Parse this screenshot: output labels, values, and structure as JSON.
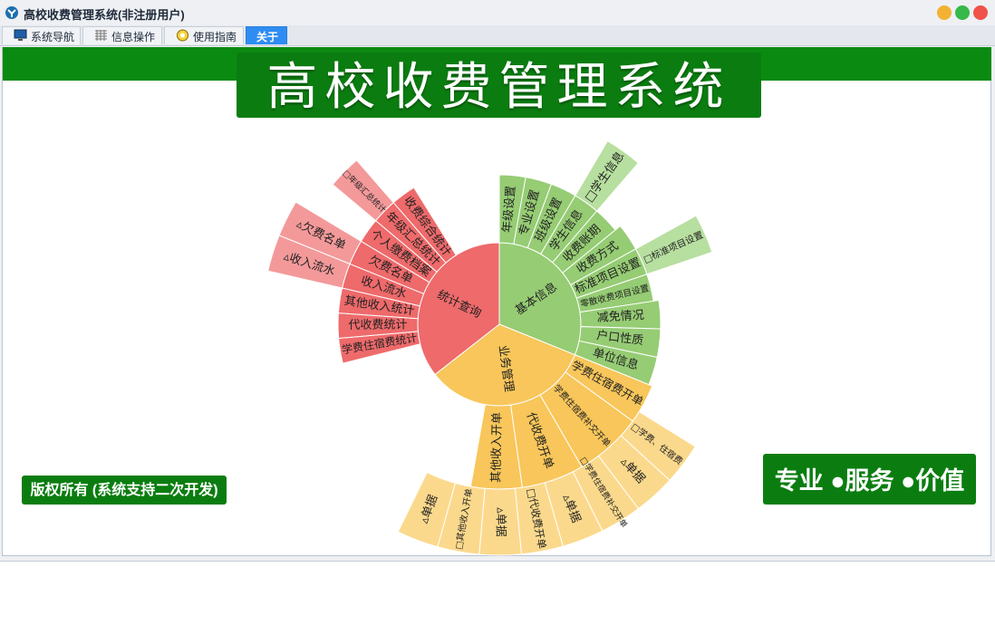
{
  "window": {
    "title": "高校收费管理系统(非注册用户)",
    "icon": "app-logo-icon"
  },
  "tabs": [
    {
      "label": "系统导航",
      "icon": "monitor-icon"
    },
    {
      "label": "信息操作",
      "icon": "grid-icon"
    },
    {
      "label": "使用指南",
      "icon": "guide-icon"
    },
    {
      "label": "关于",
      "active": true
    }
  ],
  "banner": {
    "title": "高校收费管理系统"
  },
  "footer": {
    "copyright": "版权所有 (系统支持二次开发)",
    "slogan": "专业 ●服务 ●价值"
  },
  "colors": {
    "green": "#0b7d10",
    "tab_active": "#2f8cf2",
    "stats": "#ee6a6b",
    "basic": "#96cc74",
    "business": "#f8c65a"
  },
  "sunburst": {
    "center": [
      {
        "label": "统计查询",
        "color": "#ee6a6b"
      },
      {
        "label": "基本信息",
        "color": "#96cc74"
      },
      {
        "label": "业务管理",
        "color": "#f8c65a"
      }
    ],
    "stats_items": [
      "学费住宿费统计",
      "代收费统计",
      "其他收入统计",
      "收入流水",
      "欠费名单",
      "个人缴费档案",
      "年级汇总统计",
      "收费综合统计"
    ],
    "stats_outer": [
      "▵收入流水",
      "▵欠费名单",
      "□年级汇总统计"
    ],
    "basic_items": [
      "年级设置",
      "专业设置",
      "班级设置",
      "学生信息",
      "收费账期",
      "收费方式",
      "标准项目设置",
      "零散收费项目设置",
      "减免情况",
      "户口性质",
      "单位信息"
    ],
    "basic_outer": [
      "□学生信息",
      "□标准项目设置"
    ],
    "business_items": [
      "学费住宿费开单",
      "学费住宿费补交开单",
      "代收费开单",
      "其他收入开单"
    ],
    "business_outer": [
      "□学费、住宿费",
      "▵单据",
      "□学费住宿费补交开单",
      "▵单据",
      "□代收费开单",
      "▵单据",
      "□其他收入开单",
      "▵单据"
    ]
  }
}
